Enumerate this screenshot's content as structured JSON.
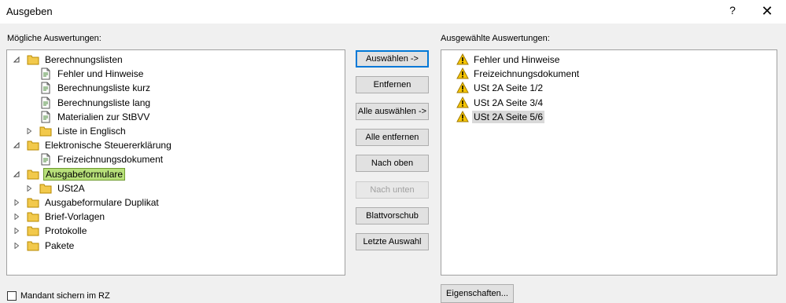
{
  "window": {
    "title": "Ausgeben",
    "help_label": "?",
    "close_label": "✕"
  },
  "left_panel": {
    "label": "Mögliche Auswertungen:"
  },
  "right_panel": {
    "label": "Ausgewählte Auswertungen:"
  },
  "tree": [
    {
      "label": "Berechnungslisten",
      "level": 0,
      "state": "expanded",
      "icon": "folder-icon"
    },
    {
      "label": "Fehler und Hinweise",
      "level": 1,
      "state": "leaf",
      "icon": "document-icon"
    },
    {
      "label": "Berechnungsliste kurz",
      "level": 1,
      "state": "leaf",
      "icon": "document-icon"
    },
    {
      "label": "Berechnungsliste lang",
      "level": 1,
      "state": "leaf",
      "icon": "document-icon"
    },
    {
      "label": "Materialien zur StBVV",
      "level": 1,
      "state": "leaf",
      "icon": "document-icon"
    },
    {
      "label": "Liste in Englisch",
      "level": 1,
      "state": "collapsed",
      "icon": "folder-icon"
    },
    {
      "label": "Elektronische Steuererklärung",
      "level": 0,
      "state": "expanded",
      "icon": "folder-icon"
    },
    {
      "label": "Freizeichnungsdokument",
      "level": 1,
      "state": "leaf",
      "icon": "document-icon"
    },
    {
      "label": "Ausgabeformulare",
      "level": 0,
      "state": "expanded",
      "icon": "folder-icon",
      "selected": true
    },
    {
      "label": "USt2A",
      "level": 1,
      "state": "collapsed",
      "icon": "folder-icon"
    },
    {
      "label": "Ausgabeformulare Duplikat",
      "level": 0,
      "state": "collapsed",
      "icon": "folder-icon"
    },
    {
      "label": "Brief-Vorlagen",
      "level": 0,
      "state": "collapsed",
      "icon": "folder-icon"
    },
    {
      "label": "Protokolle",
      "level": 0,
      "state": "collapsed",
      "icon": "folder-icon"
    },
    {
      "label": "Pakete",
      "level": 0,
      "state": "collapsed",
      "icon": "folder-icon"
    }
  ],
  "selected_list": [
    {
      "label": "Fehler und Hinweise",
      "icon": "warning-icon"
    },
    {
      "label": "Freizeichnungsdokument",
      "icon": "warning-icon"
    },
    {
      "label": "USt 2A Seite 1/2",
      "icon": "warning-icon"
    },
    {
      "label": "USt 2A Seite 3/4",
      "icon": "warning-icon"
    },
    {
      "label": "USt 2A Seite 5/6",
      "icon": "warning-icon",
      "selected": true
    }
  ],
  "buttons": [
    {
      "label": "Auswählen ->",
      "name": "select-button",
      "primary": true
    },
    {
      "label": "Entfernen",
      "name": "remove-button"
    },
    {
      "label": "Alle auswählen ->",
      "name": "select-all-button"
    },
    {
      "label": "Alle entfernen",
      "name": "remove-all-button"
    },
    {
      "label": "Nach oben",
      "name": "move-up-button"
    },
    {
      "label": "Nach unten",
      "name": "move-down-button",
      "disabled": true
    },
    {
      "label": "Blattvorschub",
      "name": "page-feed-button"
    },
    {
      "label": "Letzte Auswahl",
      "name": "last-selection-button"
    }
  ],
  "footer": {
    "checkbox_label": "Mandant sichern im RZ",
    "checkbox_checked": false,
    "properties_button": "Eigenschaften..."
  },
  "colors": {
    "tree_selection": "#b7e07a",
    "list_selection": "#d9d9d9",
    "folder": "#f2c94c",
    "warning": "#f7c600"
  }
}
